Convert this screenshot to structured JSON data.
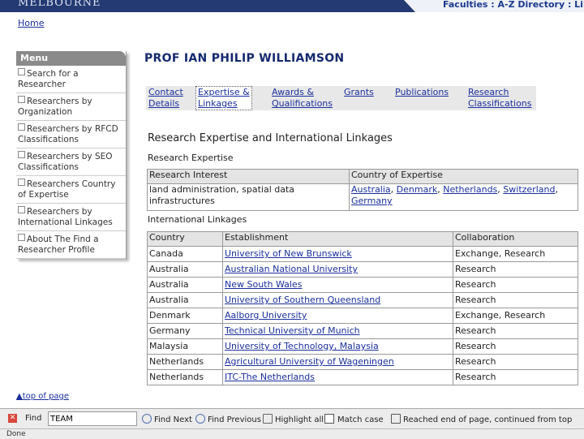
{
  "header": {
    "brand": "MELBOURNE",
    "nav": "Faculties : A-Z Directory : Lib"
  },
  "home_link": "Home",
  "menu": {
    "title": "Menu",
    "items": [
      "Search for a Researcher",
      "Researchers by Organization",
      "Researchers by RFCD Classifications",
      "Researchers by SEO Classifications",
      "Researchers Country of Expertise",
      "Researchers by International Linkages",
      "About The Find a Researcher Profile"
    ],
    "top_link": "▲top of page"
  },
  "profile": {
    "name": "PROF IAN PHILIP WILLIAMSON",
    "tabs": [
      {
        "line1": "Contact",
        "line2": "Details"
      },
      {
        "line1": "Expertise &",
        "line2": "Linkages"
      },
      {
        "line1": "Awards &",
        "line2": "Qualifications"
      },
      {
        "line1": "Grants",
        "line2": ""
      },
      {
        "line1": "Publications",
        "line2": ""
      },
      {
        "line1": "Research",
        "line2": "Classifications"
      }
    ],
    "section_title": "Research Expertise and International Linkages",
    "expertise_heading": "Research Expertise",
    "expertise_table": {
      "headers": [
        "Research Interest",
        "Country of Expertise"
      ],
      "interest": "land administration, spatial data infrastructures",
      "countries": [
        "Australia",
        "Denmark",
        "Netherlands",
        "Switzerland",
        "Germany"
      ]
    },
    "linkages_heading": "International Linkages",
    "linkages_table": {
      "headers": [
        "Country",
        "Establishment",
        "Collaboration"
      ],
      "rows": [
        [
          "Canada",
          "University of New Brunswick",
          "Exchange, Research"
        ],
        [
          "Australia",
          "Australian National University",
          "Research"
        ],
        [
          "Australia",
          "New South Wales",
          "Research"
        ],
        [
          "Australia",
          "University of Southern Queensland",
          "Research"
        ],
        [
          "Denmark",
          "Aalborg University",
          "Exchange, Research"
        ],
        [
          "Germany",
          "Technical University of Munich",
          "Research"
        ],
        [
          "Malaysia",
          "University of Technology, Malaysia",
          "Research"
        ],
        [
          "Netherlands",
          "Agricultural University of Wageningen",
          "Research"
        ],
        [
          "Netherlands",
          "ITC-The Netherlands",
          "Research"
        ]
      ]
    }
  },
  "findbar": {
    "find_label": "Find",
    "query": "TEAM",
    "next_label": "Find Next",
    "previous_label": "Find Previous",
    "highlight_label": "Highlight all",
    "match_case_label": "Match case",
    "status_message": "Reached end of page, continued from top"
  },
  "status_bar": "Done"
}
